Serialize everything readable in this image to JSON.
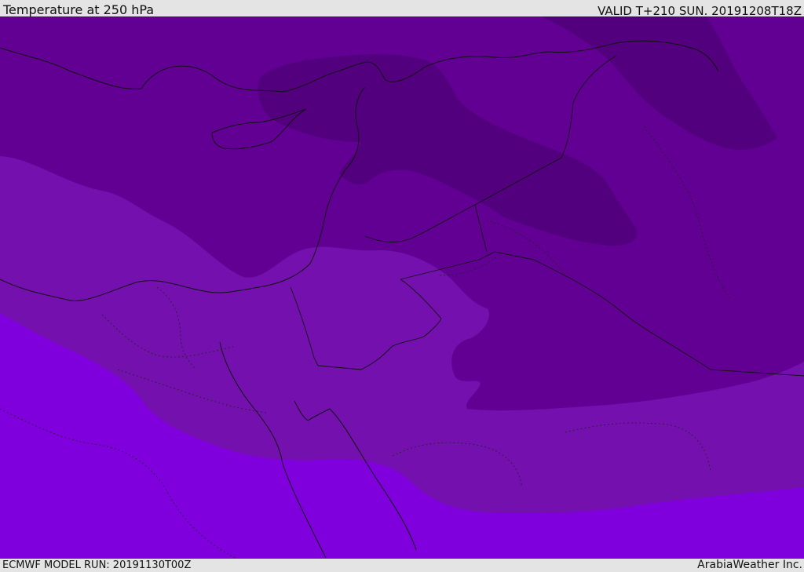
{
  "header": {
    "title": "Temperature at 250 hPa",
    "valid": "VALID T+210 SUN. 20191208T18Z"
  },
  "footer": {
    "model_run": "ECMWF MODEL RUN: 20191130T00Z",
    "credit": "ArabiaWeather Inc."
  },
  "map": {
    "palette": {
      "darkest": "#52007e",
      "dark": "#620094",
      "medium": "#7310ae",
      "light": "#7f00dd"
    }
  }
}
